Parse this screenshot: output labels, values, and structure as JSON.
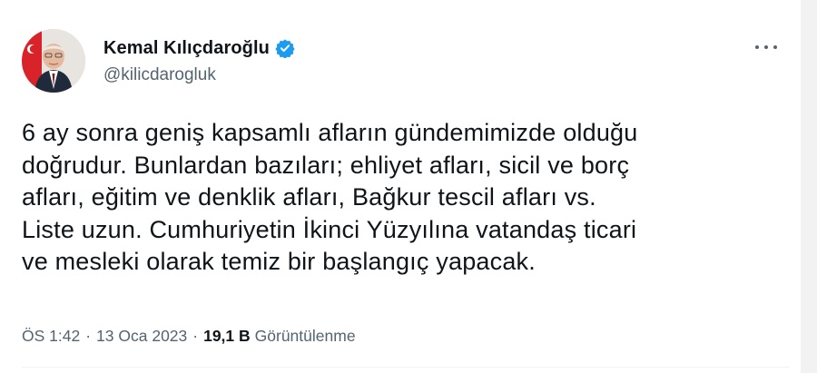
{
  "tweet": {
    "author": {
      "display_name": "Kemal Kılıçdaroğlu",
      "handle": "@kilicdarogluk",
      "verified": true,
      "avatar_icon": "profile-photo"
    },
    "more_icon": "more-horizontal-icon",
    "text": "6 ay sonra geniş kapsamlı afların gündemimizde olduğu\ndoğrudur. Bunlardan bazıları; ehliyet afları, sicil ve borç\nafları, eğitim ve denklik afları, Bağkur tescil afları vs.\nListe uzun. Cumhuriyetin İkinci Yüzyılına vatandaş ticari\nve mesleki olarak temiz bir başlangıç yapacak.",
    "meta": {
      "time": "ÖS 1:42",
      "separator": "·",
      "date": "13 Oca 2023",
      "views_count": "19,1 B",
      "views_label": "Görüntülenme"
    }
  },
  "colors": {
    "text_primary": "#0f1419",
    "text_secondary": "#536471",
    "verified_blue": "#1d9bf0"
  }
}
